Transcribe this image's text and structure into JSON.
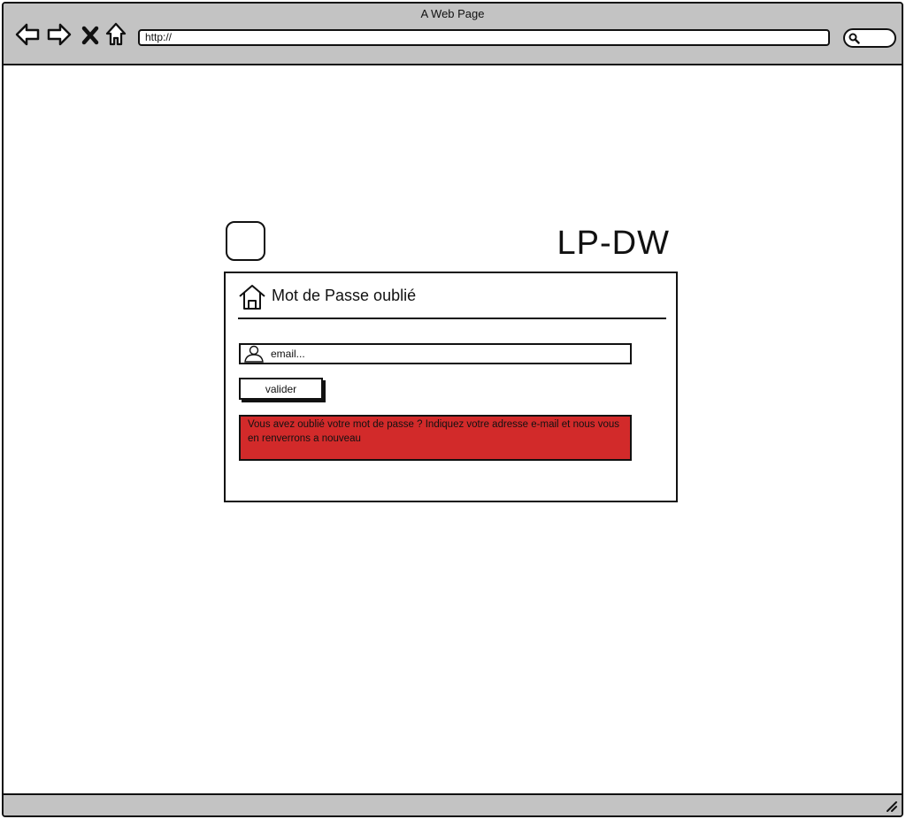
{
  "browser": {
    "window_title": "A Web Page",
    "url": "http://",
    "nav": [
      "back-icon",
      "forward-icon",
      "stop-icon",
      "home-icon"
    ],
    "search_icon": "search-icon"
  },
  "page": {
    "brand": "LP-DW",
    "logo_icon": "logo-placeholder",
    "panel": {
      "title": "Mot de Passe oublié",
      "title_icon": "home-icon",
      "email": {
        "value": "",
        "placeholder": "email...",
        "icon": "user-icon"
      },
      "submit_label": "valider",
      "alert_text": "Vous avez oublié votre mot de passe ? Indiquez votre adresse e-mail et nous vous en renverrons a nouveau"
    }
  },
  "colors": {
    "chrome": "#c3c3c3",
    "alert": "#d22a2a",
    "ink": "#111111"
  }
}
